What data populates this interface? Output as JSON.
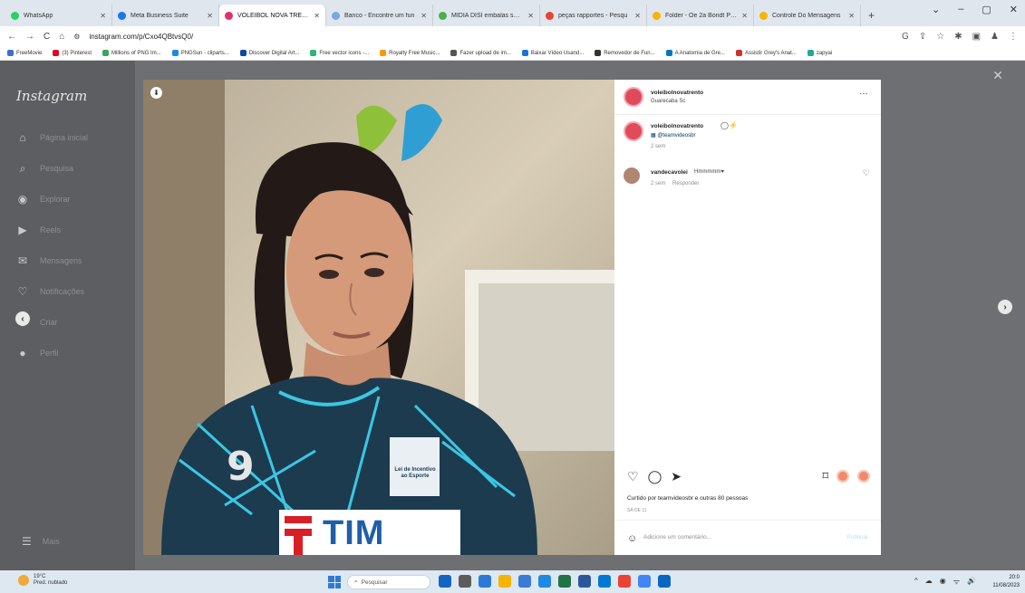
{
  "browser": {
    "tabs": [
      {
        "label": "WhatsApp",
        "color": "#25d366"
      },
      {
        "label": "Meta Business Suite",
        "color": "#1877f2"
      },
      {
        "label": "VOLEIBOL NOVA TRENTO",
        "color": "#e1306c",
        "active": true
      },
      {
        "label": "Banco - Encontre um fun",
        "color": "#7aa7e0"
      },
      {
        "label": "MÍDIA DÍSI embalas subs",
        "color": "#4caf50"
      },
      {
        "label": "peças rapportes - Pesqu",
        "color": "#ea4335"
      },
      {
        "label": "Folder - Oe 2a Bondt Para",
        "color": "#f4b400"
      },
      {
        "label": "Controle Do Mensagens",
        "color": "#f4b400"
      }
    ],
    "new_tab": "+",
    "window_controls": [
      "⌄",
      "–",
      "▢",
      "✕"
    ],
    "nav": {
      "back": "←",
      "forward": "→",
      "reload": "C",
      "home": "⌂"
    },
    "url": "instagram.com/p/Cxo4QBtvsQ0/",
    "addr_icons": [
      "G",
      "⇪",
      "☆",
      "✱",
      "▣",
      "♟",
      "⋮"
    ],
    "bookmarks": [
      {
        "label": "FreeMovie",
        "color": "#3c6fd1"
      },
      {
        "label": "(3) Pinterest",
        "color": "#e60023"
      },
      {
        "label": "Millions of PNG Im...",
        "color": "#3ba55c"
      },
      {
        "label": "PNGSun - cliparts...",
        "color": "#1e88e5"
      },
      {
        "label": "Discover Digital Art...",
        "color": "#0d47a1"
      },
      {
        "label": "Free vector icons -...",
        "color": "#2bb673"
      },
      {
        "label": "Royalty Free Music...",
        "color": "#ff9800"
      },
      {
        "label": "Fazer upload de im...",
        "color": "#555555"
      },
      {
        "label": "Baixar Vídeo Usand...",
        "color": "#1976d2"
      },
      {
        "label": "Removedor de Fun...",
        "color": "#333333"
      },
      {
        "label": "A Anatomia de Gre...",
        "color": "#0277bd"
      },
      {
        "label": "Assistir Grey's Anat...",
        "color": "#d32f2f"
      },
      {
        "label": "zapyai",
        "color": "#26a69a"
      }
    ]
  },
  "instagram": {
    "logo": "Instagram",
    "nav": [
      {
        "icon": "⌂",
        "label": "Página inicial"
      },
      {
        "icon": "⌕",
        "label": "Pesquisa"
      },
      {
        "icon": "◉",
        "label": "Explorar"
      },
      {
        "icon": "▶",
        "label": "Reels"
      },
      {
        "icon": "✉",
        "label": "Mensagens"
      },
      {
        "icon": "♡",
        "label": "Notificações"
      },
      {
        "icon": "⊕",
        "label": "Criar"
      },
      {
        "icon": "●",
        "label": "Perfil"
      }
    ],
    "more": {
      "icon": "☰",
      "label": "Mais"
    },
    "close": "✕",
    "prev": "‹",
    "next": "›"
  },
  "post": {
    "header": {
      "username": "voleibolnovatrento",
      "subtitle": "Guarecaba Sc"
    },
    "more_dots": "…",
    "caption": {
      "username": "voleibolnovatrento",
      "emojis": "◯⚡",
      "text": "▦ @teamvideosbr",
      "time": "2 sem"
    },
    "comment": {
      "username": "vandecavolei",
      "text": "Hmmmmm♥",
      "time": "2 sem",
      "reply": "Responder"
    },
    "jersey_number": "9",
    "jersey_badge": "Lei de Incentivo ao Esporte",
    "sponsor": "TIM",
    "actions": {
      "like": "♡",
      "comment": "◯",
      "share": "➤",
      "save": "⌑"
    },
    "likes_text": "Curtido por teamvideosbr e outras 80 pessoas",
    "date": "SÁ DE 11",
    "comment_placeholder": "Adicione um comentário...",
    "publish": "Publicar"
  },
  "taskbar": {
    "weather_temp": "19°C",
    "weather_desc": "Pred. nublado",
    "search": "Pesquisar",
    "apps": [
      "#1565c0",
      "#5c5c5c",
      "#2d7ad6",
      "#f4b400",
      "#3a7bd5",
      "#1e88e5",
      "#217346",
      "#2b579a",
      "#0078d4",
      "#ea4335",
      "#4285f4",
      "#0a66c2"
    ],
    "tray": [
      "^",
      "☁",
      "◉",
      "ᯤ",
      "🔊"
    ],
    "time": "20:0",
    "date": "11/08/2023"
  },
  "colors": {
    "instagram_red": "#e04b5c",
    "jersey": "#1d3b4f",
    "jersey_pattern": "#3bc7e3"
  }
}
